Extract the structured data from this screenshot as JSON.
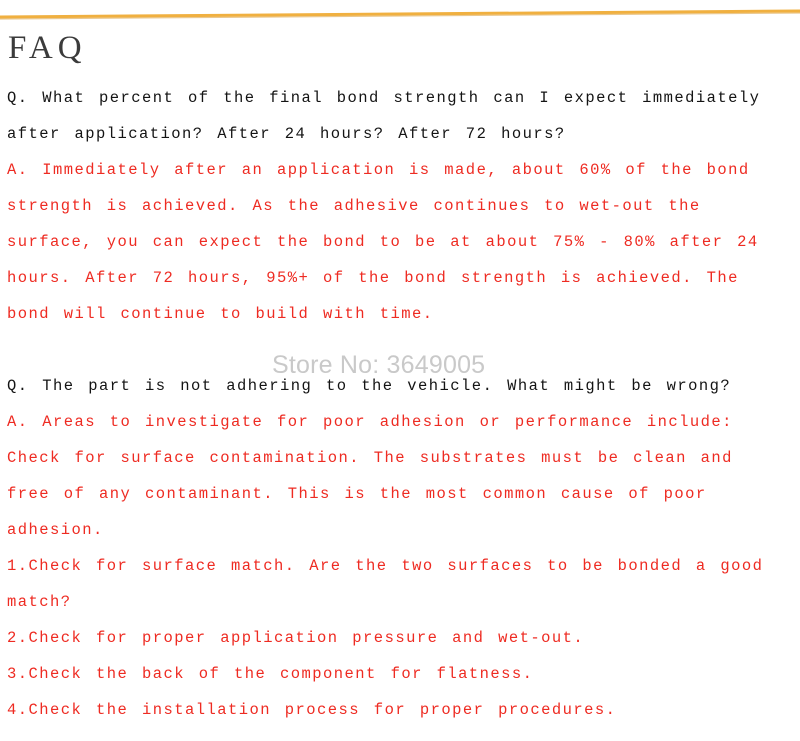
{
  "colors": {
    "rule": "#f0b040",
    "rule_shadow": "#d99a33",
    "heading": "#3b3b3b",
    "question": "#141414",
    "answer": "#ee2b22",
    "watermark": "#c9c9c9",
    "background": "#ffffff"
  },
  "heading": "FAQ",
  "watermark": "Store No: 3649005",
  "faq": [
    {
      "question": "Q. What percent of the final bond strength can I expect immediately after application? After 24 hours?  After 72 hours?",
      "answer": "A. Immediately after an application is made, about 60% of the bond strength is achieved. As the adhesive continues to wet-out the surface, you can expect the bond to be at about 75% - 80% after 24 hours. After 72 hours, 95%+ of the bond strength is achieved. The bond will continue to build with time."
    },
    {
      "question": "Q. The part is not adhering to the vehicle. What might be wrong?",
      "answer": "A. Areas to investigate for poor adhesion or performance include: Check for surface contamination. The substrates must be clean and free of any contaminant. This is the most common cause of poor adhesion.",
      "steps": [
        {
          "num": "1.",
          "text": "Check for surface match. Are the two surfaces to be bonded a good match?"
        },
        {
          "num": "2.",
          "text": "Check for proper application pressure and wet-out."
        },
        {
          "num": "3.",
          "text": "Check the back of the component for flatness."
        },
        {
          "num": "4.",
          "text": "Check the installation process for proper procedures."
        }
      ]
    }
  ]
}
